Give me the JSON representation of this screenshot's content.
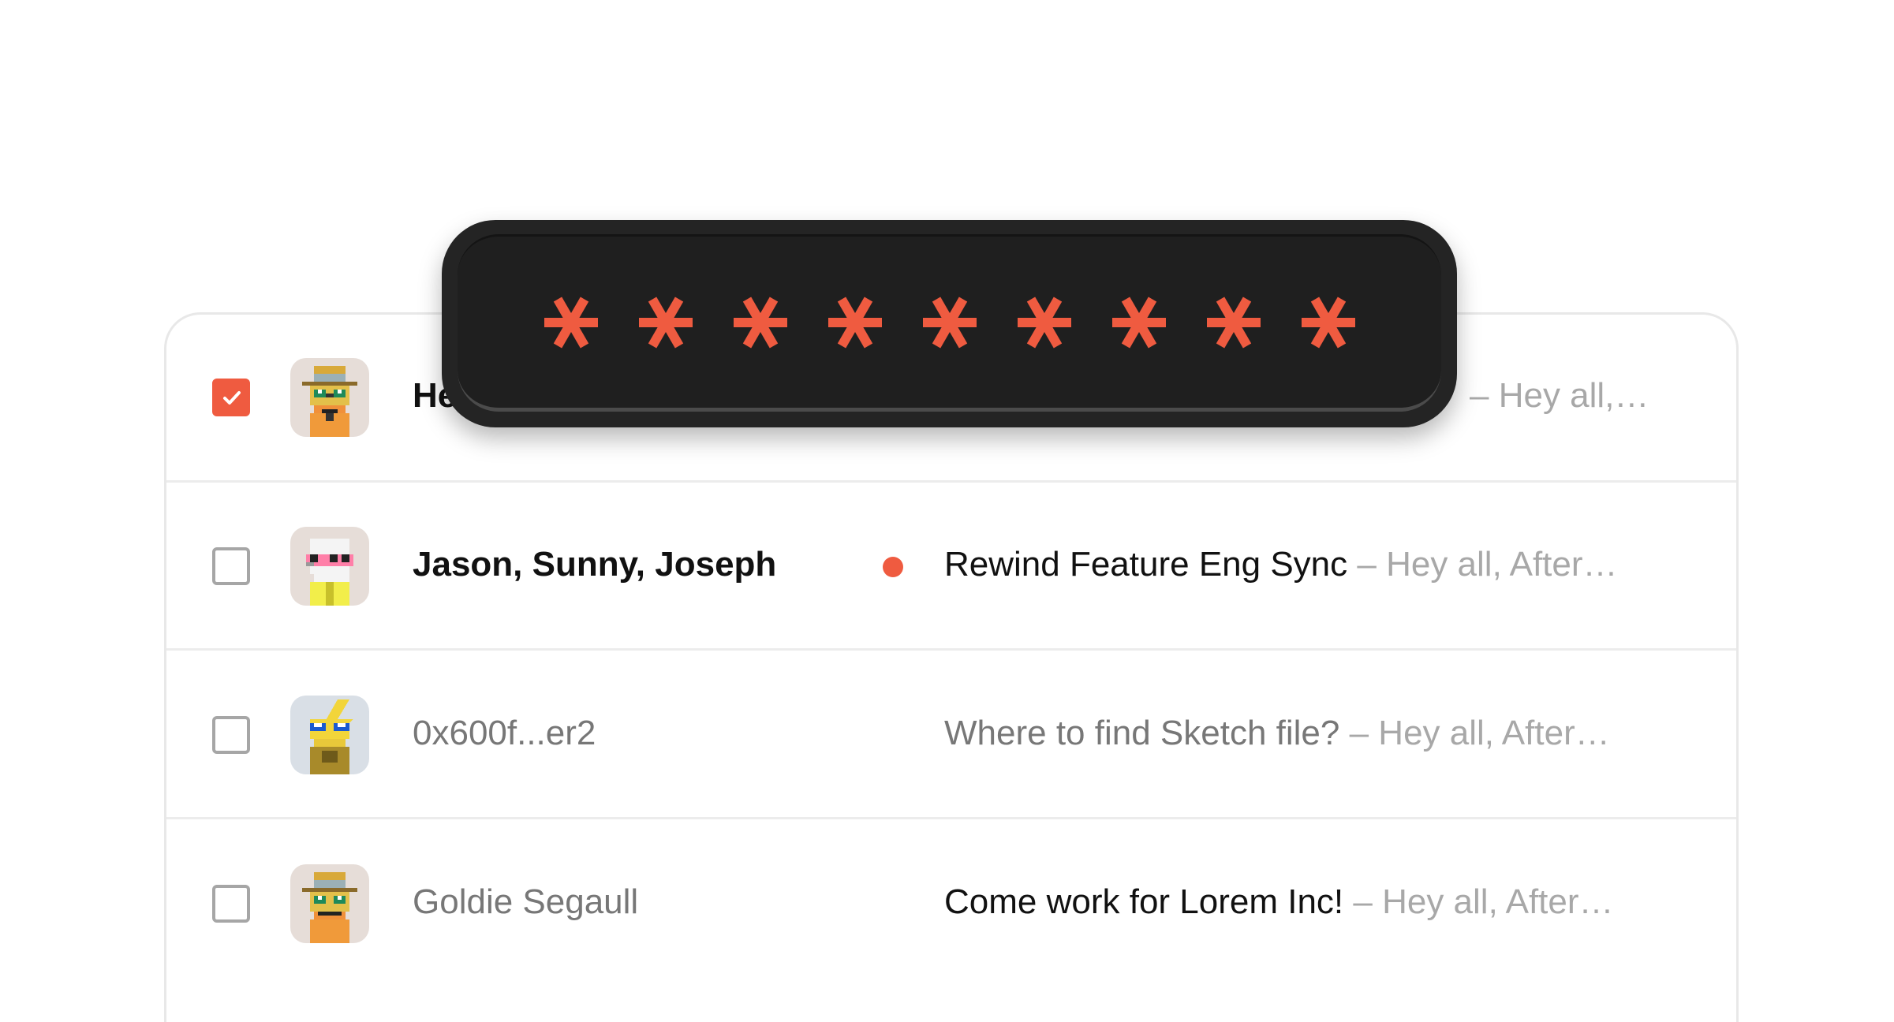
{
  "rows": [
    {
      "checked": true,
      "sender": "He",
      "sender_style": "bold",
      "unread": false,
      "subject": "",
      "preview": "– Hey all,…"
    },
    {
      "checked": false,
      "sender": "Jason, Sunny, Joseph",
      "sender_style": "bold",
      "unread": true,
      "subject": "Rewind Feature Eng Sync",
      "subject_style": "dark",
      "preview": "– Hey all, After…"
    },
    {
      "checked": false,
      "sender": "0x600f...er2",
      "sender_style": "dim",
      "unread": false,
      "subject": "Where to find Sketch file?",
      "subject_style": "gray",
      "preview": "– Hey all, After…"
    },
    {
      "checked": false,
      "sender": "Goldie Segaull",
      "sender_style": "dim",
      "unread": false,
      "subject": "Come work for Lorem Inc!",
      "subject_style": "dark",
      "preview": "– Hey all, After…"
    }
  ],
  "password": {
    "masked": "*********",
    "length": 9,
    "mask_icon": "asterisk-icon"
  },
  "colors": {
    "accent": "#ef5b40",
    "overlay_bg": "#242424"
  }
}
